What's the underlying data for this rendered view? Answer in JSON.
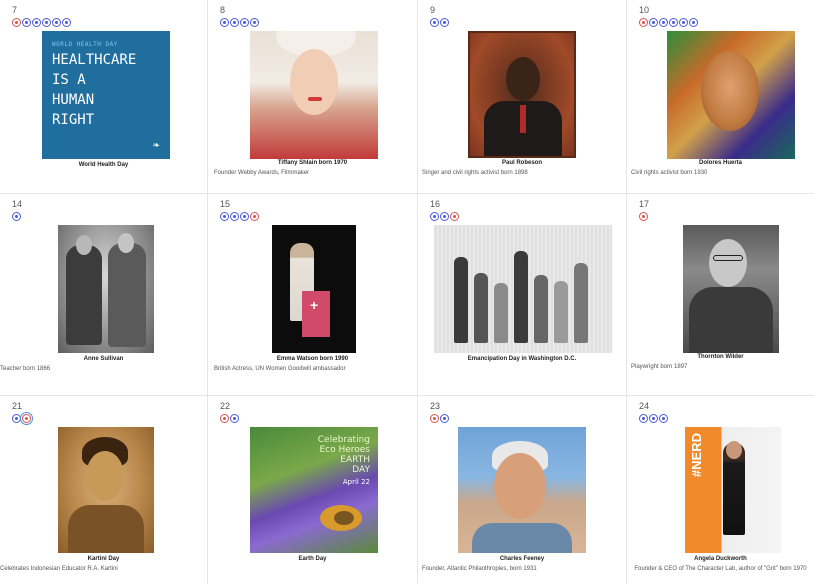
{
  "calendar": {
    "days": [
      {
        "num": "7",
        "dots": [
          "red",
          "blue",
          "blue",
          "blue",
          "blue",
          "blue"
        ],
        "caption": "World Health Day",
        "desc": "",
        "poster": {
          "small": "WORLD HEALTH DAY",
          "lines": [
            "HEALTHCARE",
            "IS A",
            "HUMAN",
            "RIGHT"
          ]
        }
      },
      {
        "num": "8",
        "dots": [
          "blue",
          "blue",
          "blue",
          "blue"
        ],
        "caption": "Tiffany Shlain born 1970",
        "desc": "Founder Webby Awards, Filmmaker"
      },
      {
        "num": "9",
        "dots": [
          "blue",
          "blue"
        ],
        "caption": "Paul Robeson",
        "desc": "Singer and civil rights activist born 1898"
      },
      {
        "num": "10",
        "dots": [
          "red",
          "blue",
          "blue",
          "blue",
          "blue",
          "blue"
        ],
        "caption": "Dolores Huerta",
        "desc": "Civil rights activist born 1930"
      },
      {
        "num": "14",
        "dots": [
          "blue"
        ],
        "caption": "Anne Sullivan",
        "desc": "Teacher born 1866"
      },
      {
        "num": "15",
        "dots": [
          "blue",
          "blue",
          "blue",
          "red"
        ],
        "caption": "Emma Watson born 1990",
        "desc": "British Actress, UN Women Goodwill ambassador"
      },
      {
        "num": "16",
        "dots": [
          "blue",
          "blue",
          "red"
        ],
        "caption": "Emancipation Day in Washington D.C.",
        "desc": ""
      },
      {
        "num": "17",
        "dots": [
          "red"
        ],
        "caption": "Thornton Wilder",
        "desc": "Playwright born 1897"
      },
      {
        "num": "21",
        "dots": [
          "blue",
          "red"
        ],
        "caption": "Kartini Day",
        "desc": "Celebrates Indonesian Educator R.A. Kartini"
      },
      {
        "num": "22",
        "dots": [
          "red",
          "blue"
        ],
        "caption": "Earth Day",
        "desc": "",
        "earth": {
          "lines": [
            "Celebrating",
            "Eco Heroes",
            "EARTH",
            "DAY"
          ],
          "date": "April 22"
        }
      },
      {
        "num": "23",
        "dots": [
          "red",
          "blue"
        ],
        "caption": "Charles Feeney",
        "desc": "Founder, Atlantic Philanthropies, born 1931"
      },
      {
        "num": "24",
        "dots": [
          "blue",
          "blue",
          "blue"
        ],
        "caption": "Angela Duckworth",
        "desc": "Founder & CEO of The Character Lab, author of \"Grit\" born 1970",
        "banner": "#NERD"
      }
    ]
  },
  "colors": {
    "blue_dot": "#4a5bd9",
    "red_dot": "#d9534f",
    "grid_line": "#e6e6e6"
  }
}
